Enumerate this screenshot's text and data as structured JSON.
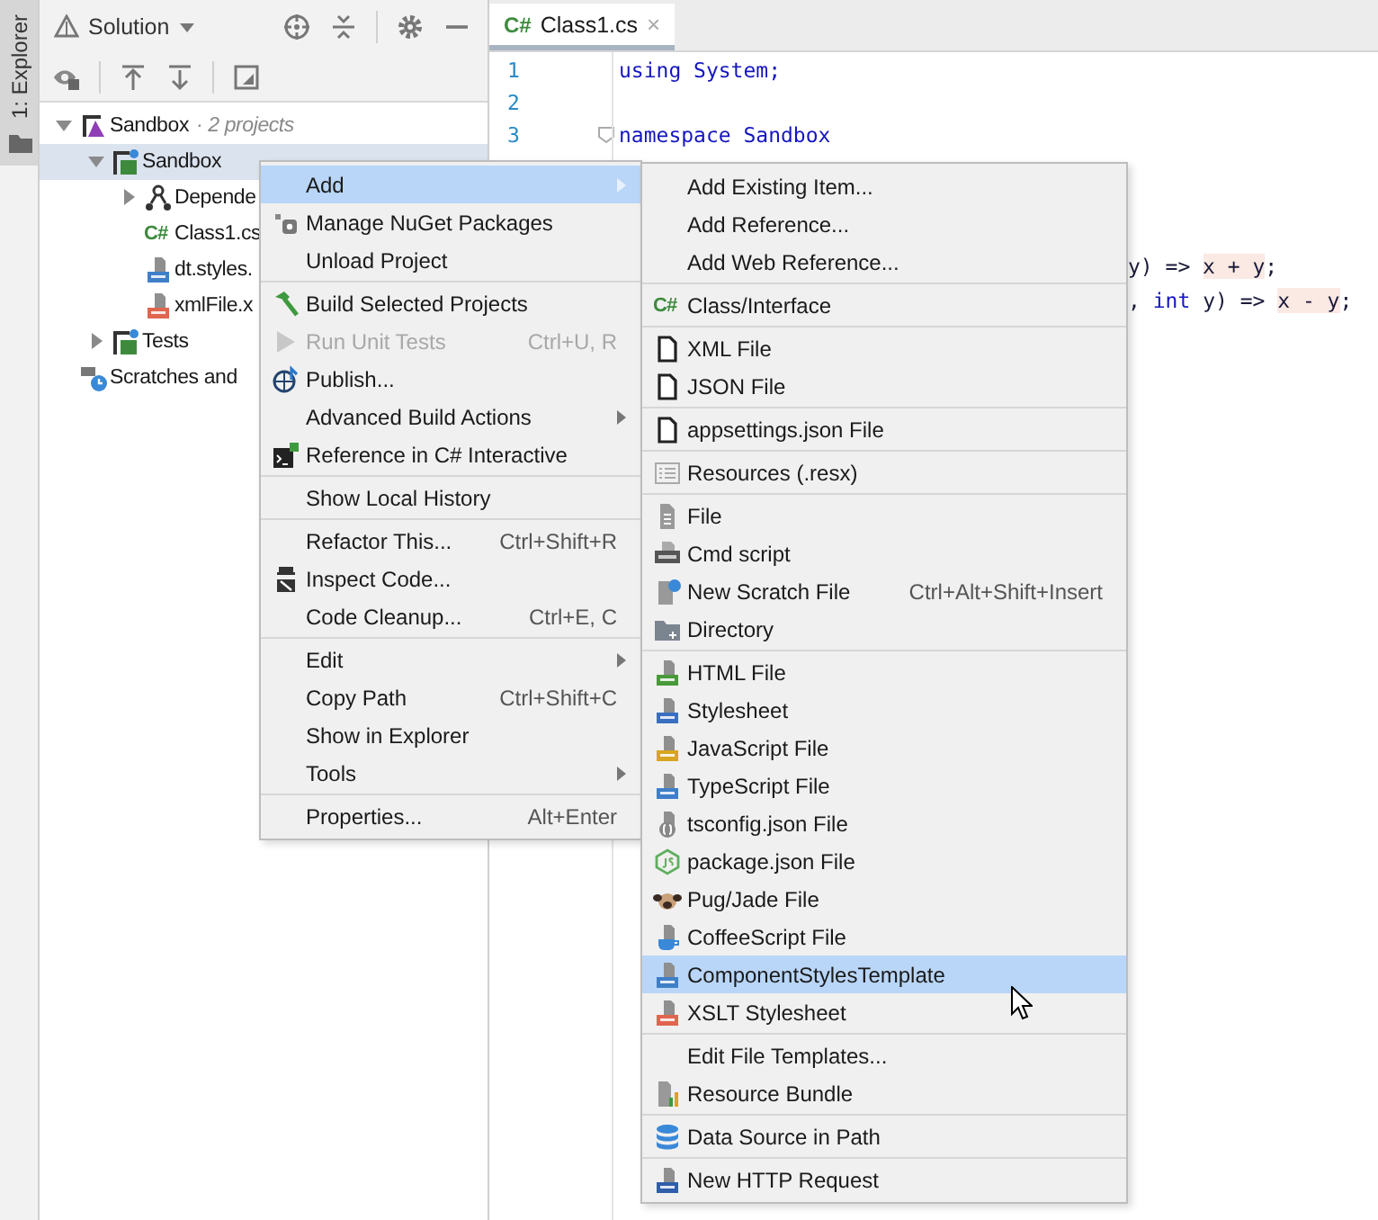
{
  "tool_strip": {
    "label": "1: Explorer",
    "selected": true
  },
  "explorer": {
    "title": "Solution",
    "tree": [
      {
        "label": "Sandbox",
        "note": "· 2 projects",
        "kind": "solution",
        "expanded": true,
        "selected": false,
        "children": [
          {
            "label": "Sandbox",
            "kind": "project",
            "expanded": true,
            "selected": true,
            "children": [
              {
                "label": "Depende",
                "kind": "deps",
                "expanded": false,
                "selected": false
              },
              {
                "label": "Class1.cs",
                "kind": "code_file",
                "badge": "C#",
                "selected": false
              },
              {
                "label": "dt.styles.",
                "kind": "ts",
                "selected": false
              },
              {
                "label": "xmlFile.x",
                "kind": "xml",
                "selected": false
              }
            ]
          },
          {
            "label": "Tests",
            "kind": "project",
            "expanded": false,
            "selected": false
          }
        ]
      },
      {
        "label": "Scratches and",
        "kind": "scratches",
        "selected": false
      }
    ]
  },
  "editor": {
    "tab": {
      "badge": "C#",
      "label": "Class1.cs",
      "close": "×",
      "selected": true
    },
    "lines": [
      {
        "number": "1",
        "fold": false,
        "parts": [
          {
            "text": "using System;",
            "kind": "keyword"
          }
        ]
      },
      {
        "number": "2",
        "fold": false
      },
      {
        "number": "3",
        "fold": true,
        "parts": [
          {
            "text": "namespace Sandbox",
            "kind": "keyword"
          }
        ]
      }
    ],
    "fragments": [
      {
        "parts": [
          {
            "text": "y) => ",
            "kind": "plain"
          },
          {
            "text": "x + y",
            "kind": "highlight"
          },
          {
            "text": ";",
            "kind": "plain"
          }
        ]
      },
      {
        "parts": [
          {
            "text": ", ",
            "kind": "plain"
          },
          {
            "text": "int",
            "kind": "keyword"
          },
          {
            "text": " y) => ",
            "kind": "plain"
          },
          {
            "text": "x - y",
            "kind": "highlight"
          },
          {
            "text": ";",
            "kind": "plain"
          }
        ]
      }
    ]
  },
  "context_menu": {
    "items": [
      {
        "kind": "item",
        "label": "Add",
        "has_submenu": true,
        "disabled": false,
        "selected": true
      },
      {
        "kind": "item",
        "label": "Manage NuGet Packages",
        "has_submenu": false,
        "disabled": false,
        "selected": false
      },
      {
        "kind": "item",
        "label": "Unload Project",
        "has_submenu": false,
        "disabled": false,
        "selected": false
      },
      {
        "kind": "separator"
      },
      {
        "kind": "item",
        "label": "Build Selected Projects",
        "has_submenu": false,
        "disabled": false,
        "selected": false
      },
      {
        "kind": "item",
        "label": "Run Unit Tests",
        "shortcut": "Ctrl+U, R",
        "has_submenu": false,
        "disabled": true,
        "selected": false
      },
      {
        "kind": "item",
        "label": "Publish...",
        "has_submenu": false,
        "disabled": false,
        "selected": false
      },
      {
        "kind": "item",
        "label": "Advanced Build Actions",
        "has_submenu": true,
        "disabled": false,
        "selected": false
      },
      {
        "kind": "item",
        "label": "Reference in C# Interactive",
        "has_submenu": false,
        "disabled": false,
        "selected": false
      },
      {
        "kind": "separator"
      },
      {
        "kind": "item",
        "label": "Show Local History",
        "has_submenu": false,
        "disabled": false,
        "selected": false
      },
      {
        "kind": "separator"
      },
      {
        "kind": "item",
        "label": "Refactor This...",
        "shortcut": "Ctrl+Shift+R",
        "has_submenu": false,
        "disabled": false,
        "selected": false
      },
      {
        "kind": "item",
        "label": "Inspect Code...",
        "has_submenu": false,
        "disabled": false,
        "selected": false
      },
      {
        "kind": "item",
        "label": "Code Cleanup...",
        "shortcut": "Ctrl+E, C",
        "has_submenu": false,
        "disabled": false,
        "selected": false
      },
      {
        "kind": "separator"
      },
      {
        "kind": "item",
        "label": "Edit",
        "has_submenu": true,
        "disabled": false,
        "selected": false
      },
      {
        "kind": "item",
        "label": "Copy Path",
        "shortcut": "Ctrl+Shift+C",
        "has_submenu": false,
        "disabled": false,
        "selected": false
      },
      {
        "kind": "item",
        "label": "Show in Explorer",
        "has_submenu": false,
        "disabled": false,
        "selected": false
      },
      {
        "kind": "item",
        "label": "Tools",
        "has_submenu": true,
        "disabled": false,
        "selected": false
      },
      {
        "kind": "separator"
      },
      {
        "kind": "item",
        "label": "Properties...",
        "shortcut": "Alt+Enter",
        "has_submenu": false,
        "disabled": false,
        "selected": false
      }
    ]
  },
  "submenu": {
    "items": [
      {
        "kind": "item",
        "label": "Add Existing Item...",
        "has_submenu": false,
        "disabled": false,
        "selected": false
      },
      {
        "kind": "item",
        "label": "Add Reference...",
        "has_submenu": false,
        "disabled": false,
        "selected": false
      },
      {
        "kind": "item",
        "label": "Add Web Reference...",
        "has_submenu": false,
        "disabled": false,
        "selected": false
      },
      {
        "kind": "separator"
      },
      {
        "kind": "item",
        "label": "Class/Interface",
        "badge": "C#",
        "has_submenu": false,
        "disabled": false,
        "selected": false
      },
      {
        "kind": "separator"
      },
      {
        "kind": "item",
        "label": "XML File",
        "has_submenu": false,
        "disabled": false,
        "selected": false
      },
      {
        "kind": "item",
        "label": "JSON File",
        "has_submenu": false,
        "disabled": false,
        "selected": false
      },
      {
        "kind": "separator"
      },
      {
        "kind": "item",
        "label": "appsettings.json File",
        "has_submenu": false,
        "disabled": false,
        "selected": false
      },
      {
        "kind": "separator"
      },
      {
        "kind": "item",
        "label": "Resources (.resx)",
        "has_submenu": false,
        "disabled": false,
        "selected": false
      },
      {
        "kind": "separator"
      },
      {
        "kind": "item",
        "label": "File",
        "has_submenu": false,
        "disabled": false,
        "selected": false
      },
      {
        "kind": "item",
        "label": "Cmd script",
        "has_submenu": false,
        "disabled": false,
        "selected": false
      },
      {
        "kind": "item",
        "label": "New Scratch File",
        "shortcut": "Ctrl+Alt+Shift+Insert",
        "has_submenu": false,
        "disabled": false,
        "selected": false
      },
      {
        "kind": "item",
        "label": "Directory",
        "has_submenu": false,
        "disabled": false,
        "selected": false
      },
      {
        "kind": "separator"
      },
      {
        "kind": "item",
        "label": "HTML File",
        "has_submenu": false,
        "disabled": false,
        "selected": false
      },
      {
        "kind": "item",
        "label": "Stylesheet",
        "has_submenu": false,
        "disabled": false,
        "selected": false
      },
      {
        "kind": "item",
        "label": "JavaScript File",
        "has_submenu": false,
        "disabled": false,
        "selected": false
      },
      {
        "kind": "item",
        "label": "TypeScript File",
        "has_submenu": false,
        "disabled": false,
        "selected": false
      },
      {
        "kind": "item",
        "label": "tsconfig.json File",
        "has_submenu": false,
        "disabled": false,
        "selected": false
      },
      {
        "kind": "item",
        "label": "package.json File",
        "has_submenu": false,
        "disabled": false,
        "selected": false
      },
      {
        "kind": "item",
        "label": "Pug/Jade File",
        "has_submenu": false,
        "disabled": false,
        "selected": false
      },
      {
        "kind": "item",
        "label": "CoffeeScript File",
        "has_submenu": false,
        "disabled": false,
        "selected": false
      },
      {
        "kind": "item",
        "label": "ComponentStylesTemplate",
        "has_submenu": false,
        "disabled": false,
        "selected": true
      },
      {
        "kind": "item",
        "label": "XSLT Stylesheet",
        "has_submenu": false,
        "disabled": false,
        "selected": false
      },
      {
        "kind": "separator"
      },
      {
        "kind": "item",
        "label": "Edit File Templates...",
        "has_submenu": false,
        "disabled": false,
        "selected": false
      },
      {
        "kind": "item",
        "label": "Resource Bundle",
        "has_submenu": false,
        "disabled": false,
        "selected": false
      },
      {
        "kind": "separator"
      },
      {
        "kind": "item",
        "label": "Data Source in Path",
        "has_submenu": false,
        "disabled": false,
        "selected": false
      },
      {
        "kind": "separator"
      },
      {
        "kind": "item",
        "label": "New HTTP Request",
        "has_submenu": false,
        "disabled": false,
        "selected": false
      }
    ]
  }
}
